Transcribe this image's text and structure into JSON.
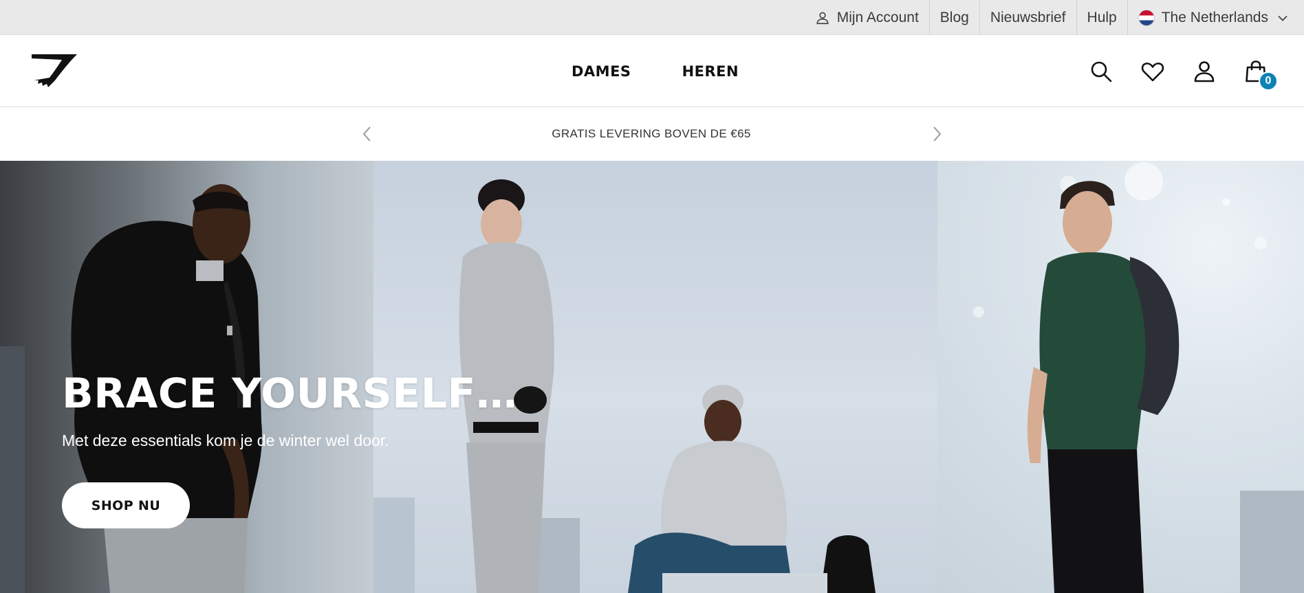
{
  "utility": {
    "account": "Mijn Account",
    "blog": "Blog",
    "newsletter": "Nieuwsbrief",
    "help": "Hulp",
    "country": "The Netherlands"
  },
  "nav": {
    "women": "DAMES",
    "men": "HEREN"
  },
  "cart": {
    "count": "0"
  },
  "promo": {
    "text": "GRATIS LEVERING BOVEN DE €65"
  },
  "hero": {
    "title": "BRACE YOURSELF…",
    "subtitle": "Met deze essentials kom je de winter wel door.",
    "cta": "SHOP NU"
  },
  "colors": {
    "utility_bg": "#e9e9e9",
    "cart_badge": "#0e83b4",
    "hero_text": "#ffffff"
  },
  "icons": {
    "account": "user-icon",
    "country": "netherlands-flag-icon",
    "dropdown": "chevron-down-icon",
    "search": "search-icon",
    "wishlist": "heart-icon",
    "profile": "user-icon",
    "cart": "shopping-bag-icon",
    "promo_prev": "chevron-left-icon",
    "promo_next": "chevron-right-icon"
  }
}
